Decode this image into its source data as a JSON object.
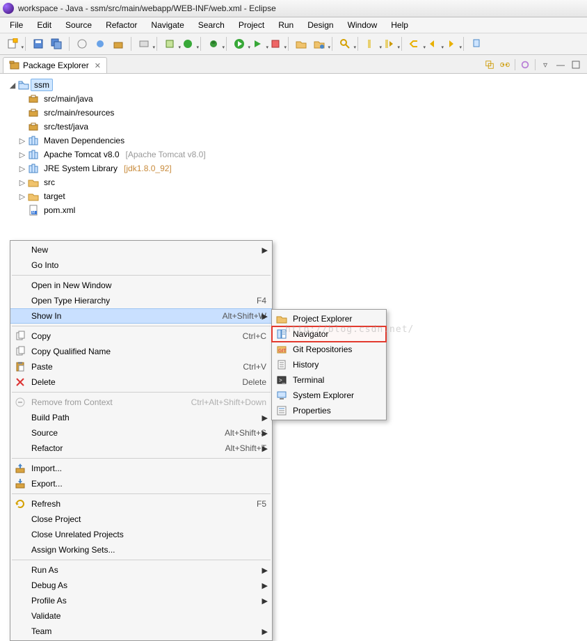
{
  "window": {
    "title": "workspace - Java - ssm/src/main/webapp/WEB-INF/web.xml - Eclipse"
  },
  "menubar": [
    "File",
    "Edit",
    "Source",
    "Refactor",
    "Navigate",
    "Search",
    "Project",
    "Run",
    "Design",
    "Window",
    "Help"
  ],
  "view": {
    "tab_label": "Package Explorer",
    "toolbar_icons": [
      "collapse-all-icon",
      "link-editor-icon",
      "filter-icon",
      "view-menu-icon",
      "minimize-icon",
      "maximize-icon"
    ]
  },
  "tree": {
    "root": {
      "label": "ssm",
      "selected": true
    },
    "children": [
      {
        "icon": "package",
        "label": "src/main/java"
      },
      {
        "icon": "package",
        "label": "src/main/resources"
      },
      {
        "icon": "package",
        "label": "src/test/java"
      },
      {
        "icon": "library",
        "twist": ">",
        "label": "Maven Dependencies"
      },
      {
        "icon": "library",
        "twist": ">",
        "label": "Apache Tomcat v8.0",
        "suffix": "[Apache Tomcat v8.0]"
      },
      {
        "icon": "library",
        "twist": ">",
        "label": "JRE System Library",
        "suffix": "[jdk1.8.0_92]",
        "suffix_color": "#c88a3a"
      },
      {
        "icon": "folder",
        "twist": ">",
        "label": "src"
      },
      {
        "icon": "folder",
        "twist": ">",
        "label": "target"
      },
      {
        "icon": "xml",
        "label": "pom.xml"
      }
    ]
  },
  "context_menu": {
    "items": [
      {
        "type": "item",
        "label": "New",
        "submenu": true
      },
      {
        "type": "item",
        "label": "Go Into"
      },
      {
        "type": "sep"
      },
      {
        "type": "item",
        "label": "Open in New Window"
      },
      {
        "type": "item",
        "label": "Open Type Hierarchy",
        "shortcut": "F4"
      },
      {
        "type": "item",
        "label": "Show In",
        "shortcut": "Alt+Shift+W",
        "submenu": true,
        "highlight": true
      },
      {
        "type": "sep"
      },
      {
        "type": "item",
        "icon": "copy-icon",
        "label": "Copy",
        "shortcut": "Ctrl+C"
      },
      {
        "type": "item",
        "icon": "copy-qualified-icon",
        "label": "Copy Qualified Name"
      },
      {
        "type": "item",
        "icon": "paste-icon",
        "label": "Paste",
        "shortcut": "Ctrl+V"
      },
      {
        "type": "item",
        "icon": "delete-icon",
        "label": "Delete",
        "shortcut": "Delete"
      },
      {
        "type": "sep"
      },
      {
        "type": "item",
        "icon": "remove-context-icon",
        "label": "Remove from Context",
        "shortcut": "Ctrl+Alt+Shift+Down",
        "disabled": true
      },
      {
        "type": "item",
        "label": "Build Path",
        "submenu": true
      },
      {
        "type": "item",
        "label": "Source",
        "shortcut": "Alt+Shift+S",
        "submenu": true
      },
      {
        "type": "item",
        "label": "Refactor",
        "shortcut": "Alt+Shift+T",
        "submenu": true
      },
      {
        "type": "sep"
      },
      {
        "type": "item",
        "icon": "import-icon",
        "label": "Import..."
      },
      {
        "type": "item",
        "icon": "export-icon",
        "label": "Export..."
      },
      {
        "type": "sep"
      },
      {
        "type": "item",
        "icon": "refresh-icon",
        "label": "Refresh",
        "shortcut": "F5"
      },
      {
        "type": "item",
        "label": "Close Project"
      },
      {
        "type": "item",
        "label": "Close Unrelated Projects"
      },
      {
        "type": "item",
        "label": "Assign Working Sets..."
      },
      {
        "type": "sep"
      },
      {
        "type": "item",
        "label": "Run As",
        "submenu": true
      },
      {
        "type": "item",
        "label": "Debug As",
        "submenu": true
      },
      {
        "type": "item",
        "label": "Profile As",
        "submenu": true
      },
      {
        "type": "item",
        "label": "Validate"
      },
      {
        "type": "item",
        "label": "Team",
        "submenu": true
      }
    ]
  },
  "sub_menu": {
    "items": [
      {
        "icon": "project-explorer-icon",
        "label": "Project Explorer"
      },
      {
        "icon": "navigator-icon",
        "label": "Navigator",
        "boxed": true
      },
      {
        "icon": "git-icon",
        "label": "Git Repositories"
      },
      {
        "icon": "history-icon",
        "label": "History"
      },
      {
        "icon": "terminal-icon",
        "label": "Terminal"
      },
      {
        "icon": "system-explorer-icon",
        "label": "System Explorer"
      },
      {
        "icon": "properties-icon",
        "label": "Properties"
      }
    ]
  },
  "watermark": "http://blog.csdn.net/"
}
